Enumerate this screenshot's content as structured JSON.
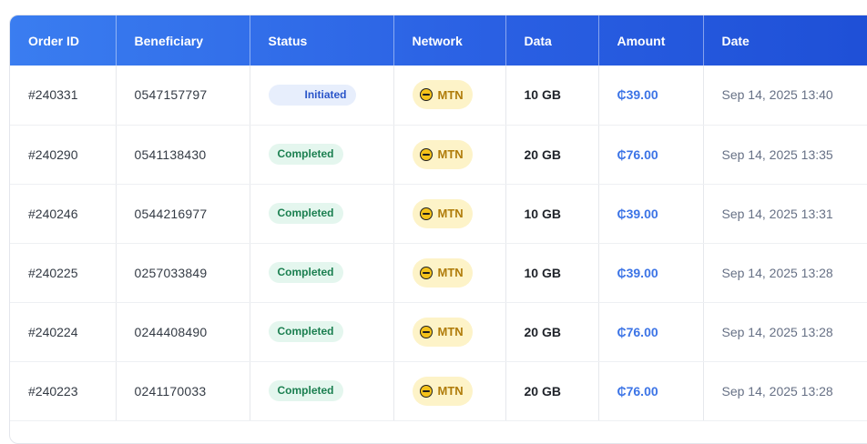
{
  "table": {
    "headers": [
      "Order ID",
      "Beneficiary",
      "Status",
      "Network",
      "Data",
      "Amount",
      "Date"
    ],
    "rows": [
      {
        "order_id": "#240331",
        "beneficiary": "0547157797",
        "status": "Initiated",
        "network": "MTN",
        "data": "10 GB",
        "amount": "₵39.00",
        "date": "Sep 14, 2025 13:40"
      },
      {
        "order_id": "#240290",
        "beneficiary": "0541138430",
        "status": "Completed",
        "network": "MTN",
        "data": "20 GB",
        "amount": "₵76.00",
        "date": "Sep 14, 2025 13:35"
      },
      {
        "order_id": "#240246",
        "beneficiary": "0544216977",
        "status": "Completed",
        "network": "MTN",
        "data": "10 GB",
        "amount": "₵39.00",
        "date": "Sep 14, 2025 13:31"
      },
      {
        "order_id": "#240225",
        "beneficiary": "0257033849",
        "status": "Completed",
        "network": "MTN",
        "data": "10 GB",
        "amount": "₵39.00",
        "date": "Sep 14, 2025 13:28"
      },
      {
        "order_id": "#240224",
        "beneficiary": "0244408490",
        "status": "Completed",
        "network": "MTN",
        "data": "20 GB",
        "amount": "₵76.00",
        "date": "Sep 14, 2025 13:28"
      },
      {
        "order_id": "#240223",
        "beneficiary": "0241170033",
        "status": "Completed",
        "network": "MTN",
        "data": "20 GB",
        "amount": "₵76.00",
        "date": "Sep 14, 2025 13:28"
      }
    ]
  },
  "colors": {
    "header_gradient_start": "#3a7df0",
    "header_gradient_end": "#1e4fd6",
    "completed_bg": "#e4f6ee",
    "completed_text": "#1b7f50",
    "initiated_bg": "#e7eefc",
    "initiated_text": "#2a55c9",
    "network_bg": "#fdf3c8",
    "network_text": "#b07c0a",
    "amount_text": "#3c74e6"
  },
  "icons": {
    "network": "mtn-logo-icon"
  }
}
